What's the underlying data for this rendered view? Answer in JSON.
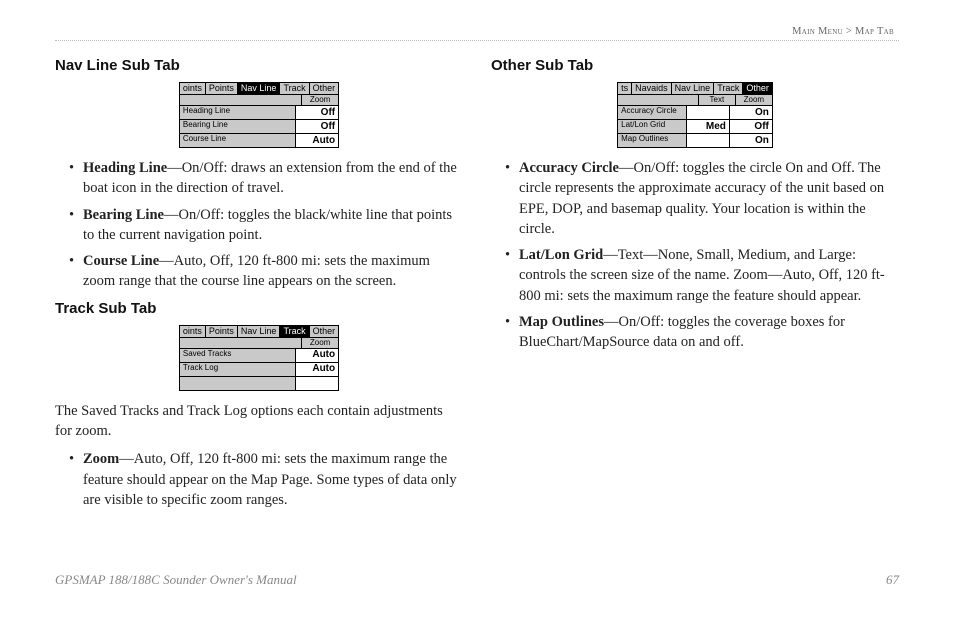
{
  "breadcrumb": {
    "a": "Main Menu",
    "sep": ">",
    "b": "Map Tab"
  },
  "left": {
    "nav": {
      "title": "Nav Line Sub Tab",
      "ui": {
        "tabs": [
          "oints",
          "Points",
          "Nav Line",
          "Track",
          "Other"
        ],
        "selected": 2,
        "col_headers": [
          "Zoom"
        ],
        "rows": [
          {
            "label": "Heading Line",
            "cells": [
              "Off"
            ]
          },
          {
            "label": "Bearing Line",
            "cells": [
              "Off"
            ]
          },
          {
            "label": "Course Line",
            "cells": [
              "Auto"
            ]
          }
        ]
      },
      "bullets": [
        {
          "term": "Heading Line",
          "text": "—On/Off: draws an extension from the end of the boat icon in the direction of travel."
        },
        {
          "term": "Bearing Line",
          "text": "—On/Off: toggles the black/white line that points to the current navigation point."
        },
        {
          "term": "Course Line",
          "text": "—Auto, Off, 120 ft-800 mi: sets the maximum zoom range that the course line appears on the screen."
        }
      ]
    },
    "track": {
      "title": "Track Sub Tab",
      "ui": {
        "tabs": [
          "oints",
          "Points",
          "Nav Line",
          "Track",
          "Other"
        ],
        "selected": 3,
        "col_headers": [
          "Zoom"
        ],
        "rows": [
          {
            "label": "Saved Tracks",
            "cells": [
              "Auto"
            ]
          },
          {
            "label": "Track Log",
            "cells": [
              "Auto"
            ]
          },
          {
            "label": "",
            "cells": [
              ""
            ]
          }
        ]
      },
      "para": "The Saved Tracks and Track Log options each contain adjustments for zoom.",
      "bullets": [
        {
          "term": "Zoom",
          "text": "—Auto, Off, 120 ft-800 mi: sets the maximum range the feature should appear on the Map Page. Some types of data only are visible to specific zoom ranges."
        }
      ]
    }
  },
  "right": {
    "other": {
      "title": "Other Sub Tab",
      "ui": {
        "tabs": [
          "ts",
          "Navaids",
          "Nav Line",
          "Track",
          "Other"
        ],
        "selected": 4,
        "col_headers": [
          "Text",
          "Zoom"
        ],
        "rows": [
          {
            "label": "Accuracy Circle",
            "cells": [
              "",
              "On"
            ]
          },
          {
            "label": "Lat/Lon Grid",
            "cells": [
              "Med",
              "Off"
            ]
          },
          {
            "label": "Map Outlines",
            "cells": [
              "",
              "On"
            ]
          }
        ]
      },
      "bullets": [
        {
          "term": "Accuracy Circle",
          "text": "—On/Off: toggles the circle On and Off. The circle represents the approximate accuracy of the unit based on EPE, DOP, and basemap quality. Your location is within the circle."
        },
        {
          "term": "Lat/Lon Grid",
          "text": "—Text—None, Small, Medium, and Large: controls the screen size of the name. Zoom—Auto, Off, 120 ft-800 mi: sets the maximum range the feature should appear."
        },
        {
          "term": "Map Outlines",
          "text": "—On/Off: toggles the coverage boxes for BlueChart/MapSource data on and off."
        }
      ]
    }
  },
  "footer": {
    "left": "GPSMAP 188/188C Sounder Owner's Manual",
    "right": "67"
  }
}
